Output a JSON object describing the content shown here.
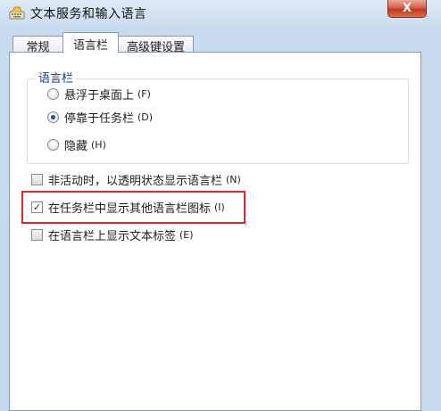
{
  "window": {
    "title": "文本服务和输入语言",
    "close_label": "X"
  },
  "tabs": [
    {
      "label": "常规",
      "active": false
    },
    {
      "label": "语言栏",
      "active": true
    },
    {
      "label": "高级键设置",
      "active": false
    }
  ],
  "language_bar_group": {
    "legend": "语言栏",
    "options": [
      {
        "label": "悬浮于桌面上",
        "shortcut": "(F)",
        "selected": false
      },
      {
        "label": "停靠于任务栏",
        "shortcut": "(D)",
        "selected": true
      },
      {
        "label": "隐藏",
        "shortcut": "(H)",
        "selected": false
      }
    ]
  },
  "checkboxes": [
    {
      "label": "非活动时，以透明状态显示语言栏",
      "shortcut": "(N)",
      "checked": false
    },
    {
      "label": "在任务栏中显示其他语言栏图标",
      "shortcut": "(I)",
      "checked": true
    },
    {
      "label": "在语言栏上显示文本标签",
      "shortcut": "(E)",
      "checked": false
    }
  ],
  "colors": {
    "highlight_border": "#e0232a",
    "titlebar": "#c9dcef",
    "close_button": "#c2381f"
  }
}
